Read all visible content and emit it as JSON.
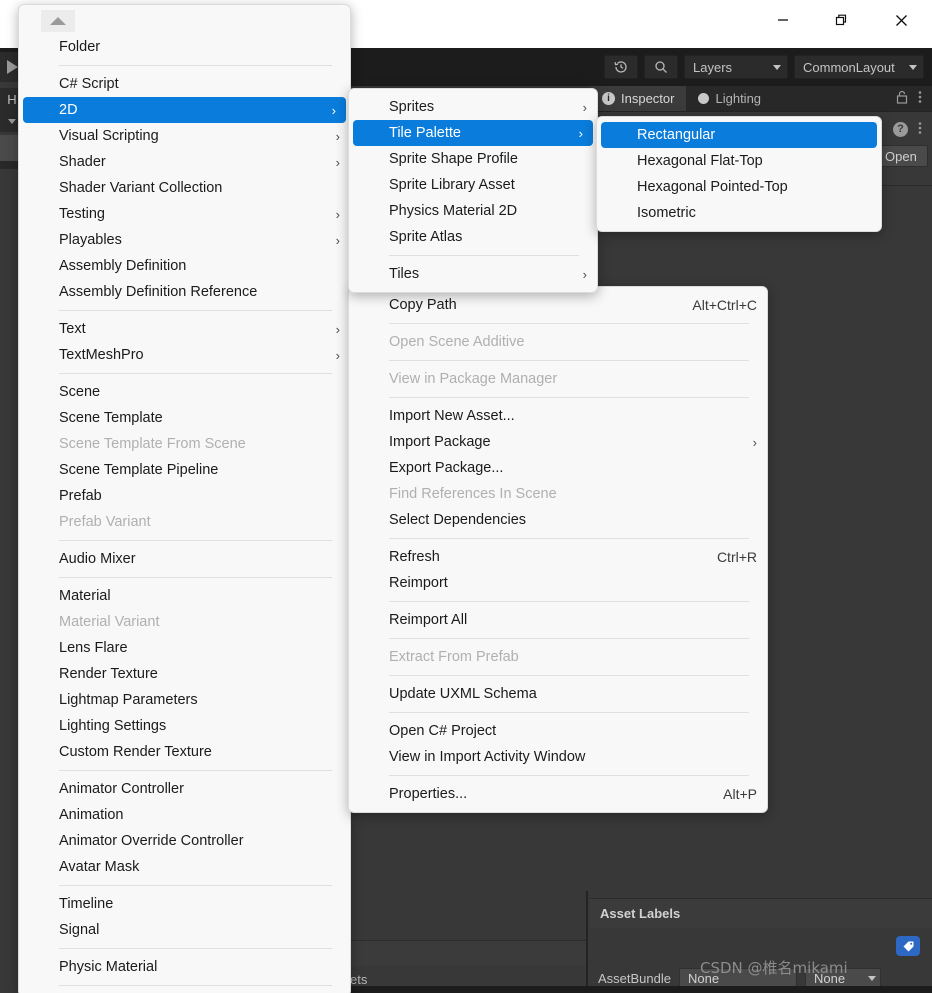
{
  "window": {
    "title_bar_buttons": [
      {
        "name": "minimize",
        "glyph": "—"
      },
      {
        "name": "maximize",
        "glyph": "❐"
      },
      {
        "name": "close",
        "glyph": "✕"
      }
    ]
  },
  "toolbar": {
    "history_icon": "history-icon",
    "search_icon": "search-icon",
    "layers_label": "Layers",
    "layout_label": "CommonLayout"
  },
  "tabs": [
    {
      "label": "Inspector",
      "icon": "info-icon",
      "active": true
    },
    {
      "label": "Lighting",
      "icon": "bulb-icon",
      "active": false
    }
  ],
  "tab_tools": {
    "lock_icon": "lock-icon",
    "menu_icon": "kebab-menu-icon"
  },
  "inspector": {
    "help_icon": "help-icon",
    "menu_icon": "kebab-menu-icon",
    "open_button": "Open"
  },
  "asset_labels": {
    "header": "Asset Labels",
    "tag_icon": "tag-icon",
    "assetbundle_label": "AssetBundle",
    "assetbundle_value": "None",
    "variant_value": "None"
  },
  "project_panel": {
    "breadcrumb_tail": "ets"
  },
  "watermark": "CSDN @椎名mikami",
  "left_rail": {
    "play_icon": "play-icon",
    "h_label": "H",
    "caret_icon": "chevron-down-icon"
  },
  "menus": {
    "create": {
      "name": "Create",
      "scroll_up_icon": "scroll-up-arrow",
      "items": [
        {
          "label": "Folder"
        },
        {
          "sep": true
        },
        {
          "label": "C# Script"
        },
        {
          "label": "2D",
          "submenu": true,
          "highlight": true
        },
        {
          "label": "Visual Scripting",
          "submenu": true
        },
        {
          "label": "Shader",
          "submenu": true
        },
        {
          "label": "Shader Variant Collection"
        },
        {
          "label": "Testing",
          "submenu": true
        },
        {
          "label": "Playables",
          "submenu": true
        },
        {
          "label": "Assembly Definition"
        },
        {
          "label": "Assembly Definition Reference"
        },
        {
          "sep": true
        },
        {
          "label": "Text",
          "submenu": true
        },
        {
          "label": "TextMeshPro",
          "submenu": true
        },
        {
          "sep": true
        },
        {
          "label": "Scene"
        },
        {
          "label": "Scene Template"
        },
        {
          "label": "Scene Template From Scene",
          "disabled": true
        },
        {
          "label": "Scene Template Pipeline"
        },
        {
          "label": "Prefab"
        },
        {
          "label": "Prefab Variant",
          "disabled": true
        },
        {
          "sep": true
        },
        {
          "label": "Audio Mixer"
        },
        {
          "sep": true
        },
        {
          "label": "Material"
        },
        {
          "label": "Material Variant",
          "disabled": true
        },
        {
          "label": "Lens Flare"
        },
        {
          "label": "Render Texture"
        },
        {
          "label": "Lightmap Parameters"
        },
        {
          "label": "Lighting Settings"
        },
        {
          "label": "Custom Render Texture"
        },
        {
          "sep": true
        },
        {
          "label": "Animator Controller"
        },
        {
          "label": "Animation"
        },
        {
          "label": "Animator Override Controller"
        },
        {
          "label": "Avatar Mask"
        },
        {
          "sep": true
        },
        {
          "label": "Timeline"
        },
        {
          "label": "Signal"
        },
        {
          "sep": true
        },
        {
          "label": "Physic Material"
        },
        {
          "sep": true
        }
      ]
    },
    "two_d": {
      "name": "2D",
      "items": [
        {
          "label": "Sprites",
          "submenu": true
        },
        {
          "label": "Tile Palette",
          "submenu": true,
          "highlight": true
        },
        {
          "label": "Sprite Shape Profile"
        },
        {
          "label": "Sprite Library Asset"
        },
        {
          "label": "Physics Material 2D"
        },
        {
          "label": "Sprite Atlas"
        },
        {
          "sep": true
        },
        {
          "label": "Tiles",
          "submenu": true
        }
      ]
    },
    "tile_palette": {
      "name": "Tile Palette",
      "items": [
        {
          "label": "Rectangular",
          "highlight": true
        },
        {
          "label": "Hexagonal Flat-Top"
        },
        {
          "label": "Hexagonal Pointed-Top"
        },
        {
          "label": "Isometric"
        }
      ]
    },
    "asset": {
      "name": "Assets Context Menu",
      "items": [
        {
          "label": "Copy Path",
          "shortcut": "Alt+Ctrl+C"
        },
        {
          "sep": true
        },
        {
          "label": "Open Scene Additive",
          "disabled": true
        },
        {
          "sep": true
        },
        {
          "label": "View in Package Manager",
          "disabled": true
        },
        {
          "sep": true
        },
        {
          "label": "Import New Asset..."
        },
        {
          "label": "Import Package",
          "submenu": true
        },
        {
          "label": "Export Package..."
        },
        {
          "label": "Find References In Scene",
          "disabled": true
        },
        {
          "label": "Select Dependencies"
        },
        {
          "sep": true
        },
        {
          "label": "Refresh",
          "shortcut": "Ctrl+R"
        },
        {
          "label": "Reimport"
        },
        {
          "sep": true
        },
        {
          "label": "Reimport All"
        },
        {
          "sep": true
        },
        {
          "label": "Extract From Prefab",
          "disabled": true
        },
        {
          "sep": true
        },
        {
          "label": "Update UXML Schema"
        },
        {
          "sep": true
        },
        {
          "label": "Open C# Project"
        },
        {
          "label": "View in Import Activity Window"
        },
        {
          "sep": true
        },
        {
          "label": "Properties...",
          "shortcut": "Alt+P"
        }
      ]
    }
  },
  "colors": {
    "accent": "#0a7cdb",
    "menu_bg": "#f8f8f8",
    "editor_bg": "#383838",
    "toolbar_bg": "#1c1c1c",
    "tag_badge": "#2c68c4"
  }
}
